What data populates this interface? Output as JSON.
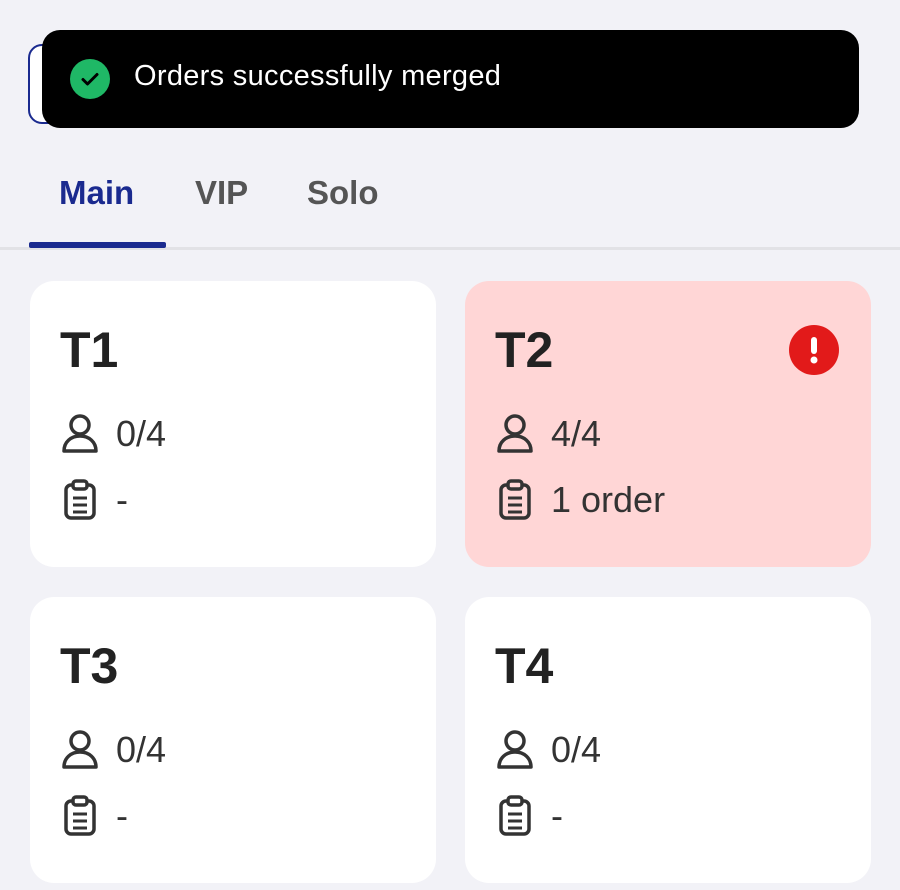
{
  "toast": {
    "message": "Orders successfully merged",
    "icon": "check-circle-icon",
    "status_color": "#1fb866"
  },
  "tabs": [
    {
      "label": "Main",
      "active": true
    },
    {
      "label": "VIP",
      "active": false
    },
    {
      "label": "Solo",
      "active": false
    }
  ],
  "accent_color": "#1a2a8f",
  "alert_color": "#e21a1a",
  "tables": [
    {
      "name": "T1",
      "guests": "0/4",
      "orders": "-",
      "alert": false
    },
    {
      "name": "T2",
      "guests": "4/4",
      "orders": "1 order",
      "alert": true
    },
    {
      "name": "T3",
      "guests": "0/4",
      "orders": "-",
      "alert": false
    },
    {
      "name": "T4",
      "guests": "0/4",
      "orders": "-",
      "alert": false
    }
  ]
}
